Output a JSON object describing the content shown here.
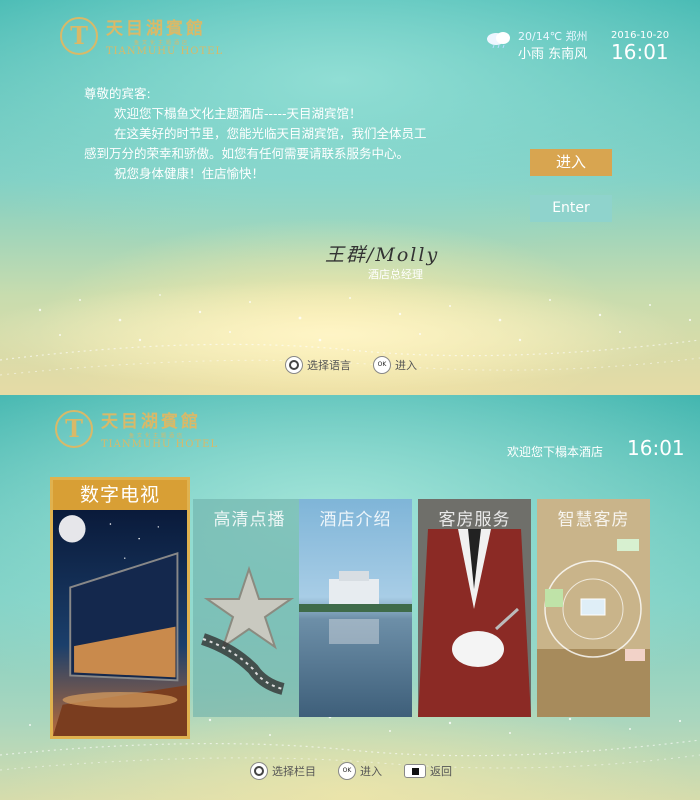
{
  "hotel": {
    "name_cn": "天目湖賓館",
    "name_en": "TIANMUHU HOTEL",
    "tagline": "鱼文化主题酒店",
    "logo_letter": "T"
  },
  "welcome_screen": {
    "weather": {
      "temp_city": "20/14℃ 郑州",
      "desc": "小雨 东南风"
    },
    "date": "2016-10-20",
    "time": "16:01",
    "greeting": "尊敬的宾客:",
    "lines": [
      "欢迎您下榻鱼文化主题酒店-----天目湖宾馆！",
      "在这美好的时节里，您能光临天目湖宾馆，我们全体员工",
      "感到万分的荣幸和骄傲。如您有任何需要请联系服务中心。",
      "祝您身体健康！住店愉快！"
    ],
    "enter_cn": "进入",
    "enter_en": "Enter",
    "signature": "王群/Molly",
    "signature_title": "酒店总经理",
    "hints": {
      "select_language": "选择语言",
      "enter": "进入"
    }
  },
  "menu_screen": {
    "welcome": "欢迎您下榻本酒店",
    "time": "16:01",
    "cards": [
      {
        "label": "数字电视",
        "active": true
      },
      {
        "label": "高清点播",
        "active": false
      },
      {
        "label": "酒店介绍",
        "active": false
      },
      {
        "label": "客房服务",
        "active": false
      },
      {
        "label": "智慧客房",
        "active": false
      }
    ],
    "hints": {
      "select_column": "选择栏目",
      "enter": "进入",
      "back": "返回"
    }
  },
  "colors": {
    "accent_gold": "#d8a550",
    "teal": "#3fb6b0"
  },
  "icons": [
    "cloud-rain-icon",
    "dpad-icon",
    "ok-icon",
    "back-icon"
  ]
}
